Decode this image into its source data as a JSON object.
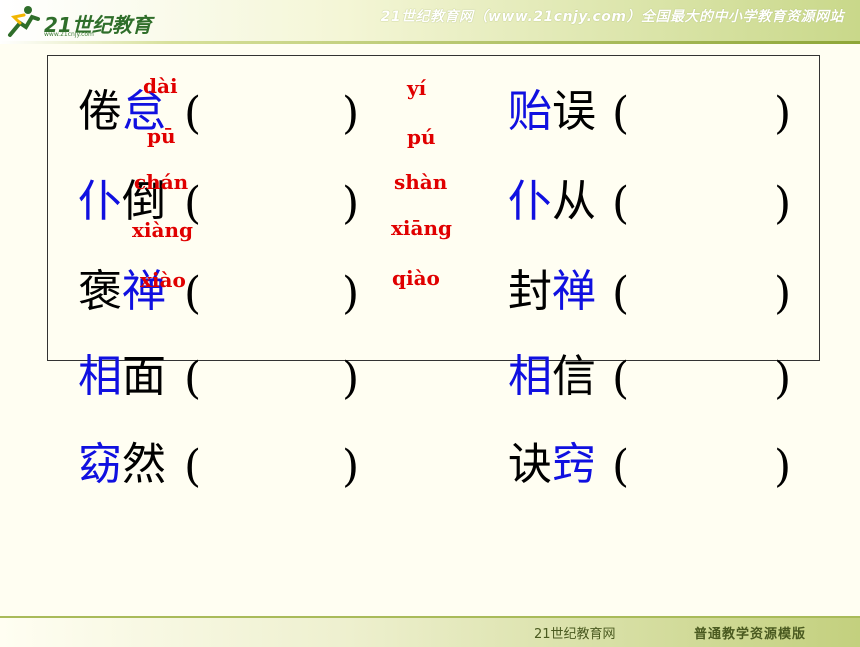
{
  "header": {
    "logo_text": "21世纪教育",
    "logo_sub": "www.21cnjy.com",
    "slogan": "21世纪教育网（www.21cnjy.com）全国最大的中小学教育资源网站"
  },
  "footer": {
    "left": "21世纪教育网",
    "right": "普通教学资源模版"
  },
  "rows": [
    {
      "left": [
        {
          "t": "倦",
          "c": "black"
        },
        {
          "t": "怠",
          "c": "blue"
        }
      ],
      "right": [
        {
          "t": "贻",
          "c": "blue"
        },
        {
          "t": "误",
          "c": "black"
        }
      ]
    },
    {
      "left": [
        {
          "t": "仆",
          "c": "blue"
        },
        {
          "t": "倒",
          "c": "black"
        }
      ],
      "right": [
        {
          "t": "仆",
          "c": "blue"
        },
        {
          "t": "从",
          "c": "black"
        }
      ]
    },
    {
      "left": [
        {
          "t": "褒",
          "c": "black"
        },
        {
          "t": "禅",
          "c": "blue"
        }
      ],
      "right": [
        {
          "t": "封",
          "c": "black"
        },
        {
          "t": "禅",
          "c": "blue"
        }
      ]
    },
    {
      "left": [
        {
          "t": "相",
          "c": "blue"
        },
        {
          "t": "面",
          "c": "black"
        }
      ],
      "right": [
        {
          "t": "相",
          "c": "blue"
        },
        {
          "t": "信",
          "c": "black"
        }
      ]
    },
    {
      "left": [
        {
          "t": "窈",
          "c": "blue"
        },
        {
          "t": "然",
          "c": "black"
        }
      ],
      "right": [
        {
          "t": "诀",
          "c": "black"
        },
        {
          "t": "窍",
          "c": "blue"
        }
      ]
    }
  ],
  "paren_open": "(",
  "paren_close": ")",
  "pinyin_left": [
    "dài",
    "pū",
    "chán",
    "xiàng",
    "xiào"
  ],
  "pinyin_mid": [
    "yí",
    "pú",
    "shàn",
    "xiāng",
    "qiào"
  ]
}
